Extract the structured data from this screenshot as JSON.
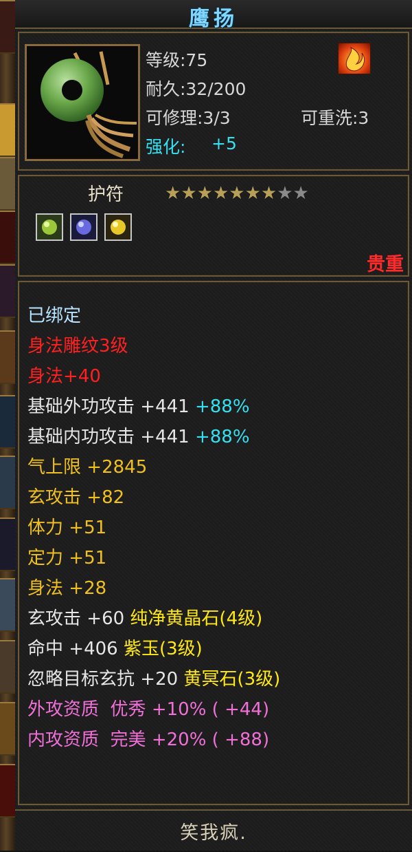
{
  "item": {
    "name": "鹰扬",
    "category": "护符",
    "rarity": "贵重",
    "stars_filled": 7,
    "stars_total": 9
  },
  "stats": {
    "level": "等级:75",
    "durability": "耐久:32/200",
    "repair": "可修理:3/3",
    "rewash": "可重洗:3",
    "enhance_label": "强化:",
    "enhance_value": "+5"
  },
  "icons": {
    "emblem": "flame-emblem-icon",
    "item": "jade-pendant-icon",
    "gems": [
      "green-gem-icon",
      "purple-gem-icon",
      "yellow-gem-icon"
    ]
  },
  "bound": "已绑定",
  "engraving": "身法雕纹3级",
  "engraving_bonus": "身法+40",
  "attributes": [
    {
      "label": "基础外功攻击",
      "value": "+441",
      "extra": "+88%"
    },
    {
      "label": "基础内功攻击",
      "value": "+441",
      "extra": "+88%"
    },
    {
      "label": "气上限",
      "value": "+2845"
    },
    {
      "label": "玄攻击",
      "value": "+82"
    },
    {
      "label": "体力",
      "value": "+51"
    },
    {
      "label": "定力",
      "value": "+51"
    },
    {
      "label": "身法",
      "value": "+28"
    }
  ],
  "gem_lines": [
    {
      "label": "玄攻击",
      "value": "+60",
      "gem": "纯净黄晶石(4级)"
    },
    {
      "label": "命中",
      "value": "+406",
      "gem": "紫玉(3级)"
    },
    {
      "label": "忽略目标玄抗",
      "value": "+20",
      "gem": "黄冥石(3级)"
    }
  ],
  "qualities": [
    {
      "label": "外攻资质",
      "grade": "优秀",
      "pct": "+10%",
      "bonus": "( +44)"
    },
    {
      "label": "内攻资质",
      "grade": "完美",
      "pct": "+20%",
      "bonus": "( +88)"
    }
  ],
  "footer": "笑我疯."
}
